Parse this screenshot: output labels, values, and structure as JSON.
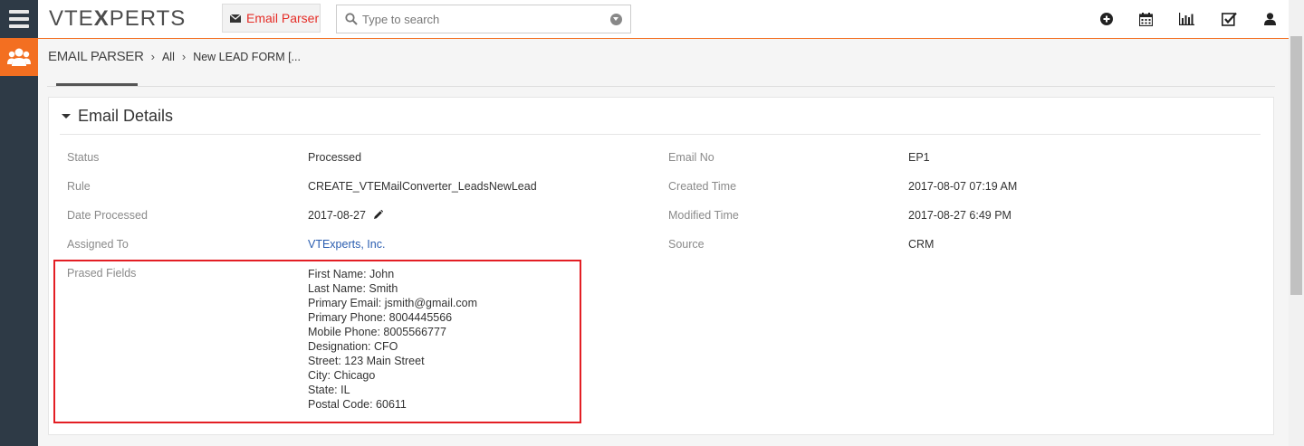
{
  "app": {
    "logo": {
      "part1": "VTE",
      "part2": "X",
      "part3": "PERTS"
    },
    "module_tab": "Email Parser",
    "search": {
      "placeholder": "Type to search"
    }
  },
  "toolbar_icons": [
    "plus-circle-icon",
    "calendar-icon",
    "bar-chart-icon",
    "checkbox-icon",
    "user-icon"
  ],
  "breadcrumb": {
    "module": "EMAIL PARSER",
    "items": [
      "All",
      "New LEAD FORM [..."
    ]
  },
  "panel": {
    "title": "Email Details",
    "left_fields": [
      {
        "label": "Status",
        "value": "Processed"
      },
      {
        "label": "Rule",
        "value": "CREATE_VTEMailConverter_LeadsNewLead"
      },
      {
        "label": "Date Processed",
        "value": "2017-08-27"
      },
      {
        "label": "Assigned To",
        "value": "VTExperts, Inc."
      },
      {
        "label": "Prased Fields",
        "value": ""
      }
    ],
    "right_fields": [
      {
        "label": "Email No",
        "value": "EP1"
      },
      {
        "label": "Created Time",
        "value": "2017-08-07 07:19 AM"
      },
      {
        "label": "Modified Time",
        "value": "2017-08-27 6:49 PM"
      },
      {
        "label": "Source",
        "value": "CRM"
      }
    ],
    "parsed_lines": [
      "First Name: John",
      "Last Name: Smith",
      "Primary Email: jsmith@gmail.com",
      "Primary Phone: 8004445566",
      "Mobile Phone: 8005566777",
      "Designation: CFO",
      "Street: 123 Main Street",
      "City: Chicago",
      "State: IL",
      "Postal Code: 60611"
    ]
  },
  "colors": {
    "accent": "#f36f21",
    "highlight_box": "#e31e24",
    "sidebar": "#2e3a46",
    "link": "#2a5db0"
  }
}
